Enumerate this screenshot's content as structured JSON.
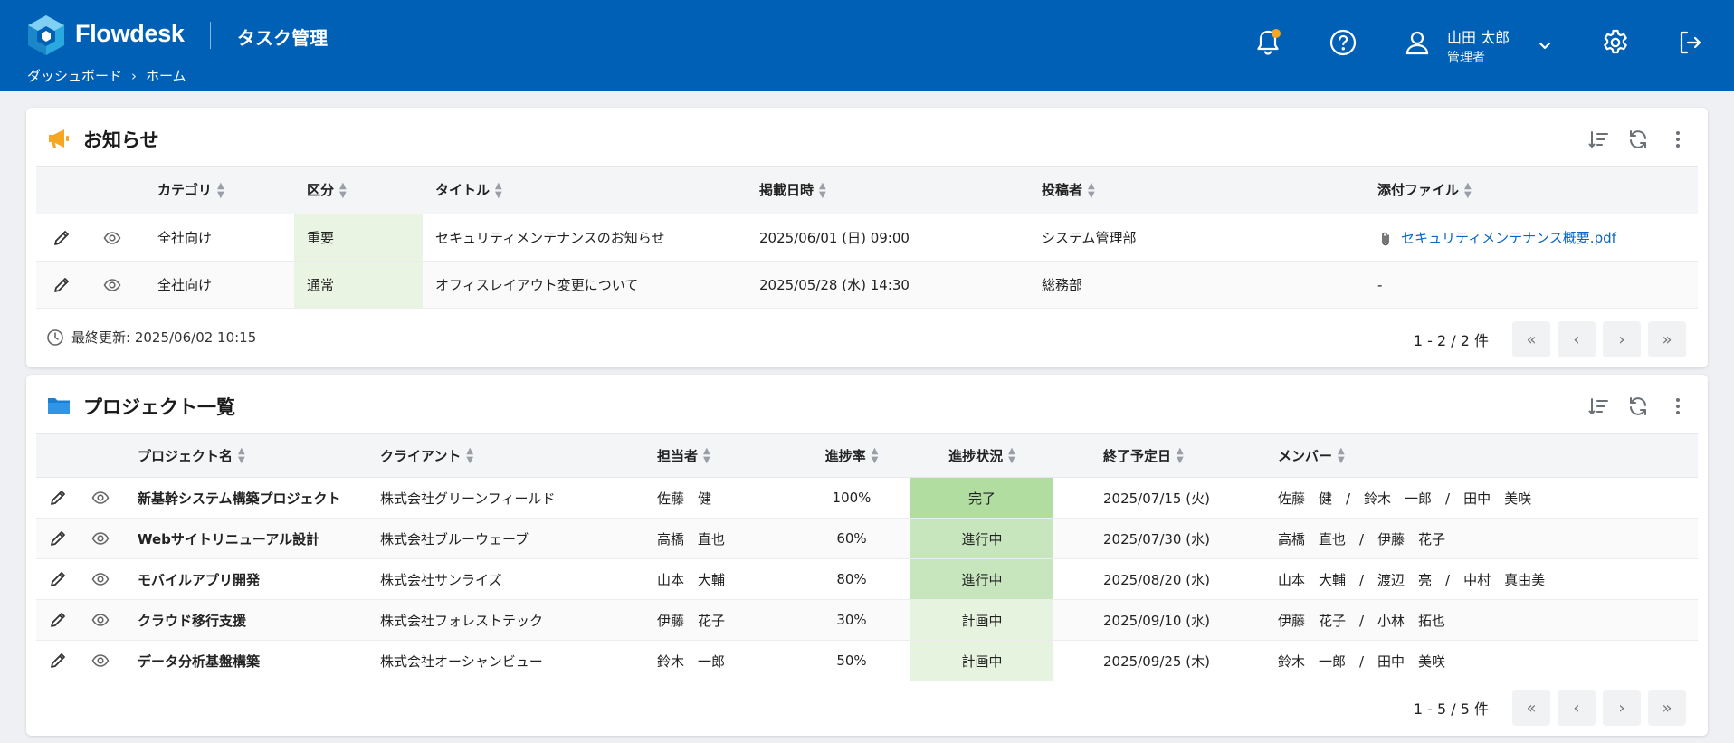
{
  "header": {
    "brand": "Flowdesk",
    "app_title": "タスク管理",
    "breadcrumb": [
      "ダッシュボード",
      "ホーム"
    ],
    "user_name": "山田 太郎",
    "user_role": "管理者"
  },
  "notices": {
    "title": "お知らせ",
    "columns": [
      "カテゴリ",
      "区分",
      "タイトル",
      "掲載日時",
      "投稿者",
      "添付ファイル"
    ],
    "rows": [
      {
        "category": "全社向け",
        "type": "重要",
        "title": "セキュリティメンテナンスのお知らせ",
        "date": "2025/06/01 (日) 09:00",
        "author": "システム管理部",
        "attachment": "セキュリティメンテナンス概要.pdf"
      },
      {
        "category": "全社向け",
        "type": "通常",
        "title": "オフィスレイアウト変更について",
        "date": "2025/05/28 (水) 14:30",
        "author": "総務部",
        "attachment": "-"
      }
    ],
    "updated": "最終更新: 2025/06/02 10:15",
    "count": "1 - 2 / 2 件"
  },
  "projects": {
    "title": "プロジェクト一覧",
    "columns": [
      "プロジェクト名",
      "クライアント",
      "担当者",
      "進捗率",
      "進捗状況",
      "終了予定日",
      "メンバー"
    ],
    "rows": [
      {
        "name": "新基幹システム構築プロジェクト",
        "client": "株式会社グリーンフィールド",
        "owner": "佐藤　健",
        "progress": "100%",
        "status": "完了",
        "due": "2025/07/15 (火)",
        "members": "佐藤　健　/　鈴木　一郎　/　田中　美咲"
      },
      {
        "name": "Webサイトリニューアル設計",
        "client": "株式会社ブルーウェーブ",
        "owner": "高橋　直也",
        "progress": "60%",
        "status": "進行中",
        "due": "2025/07/30 (水)",
        "members": "高橋　直也　/　伊藤　花子"
      },
      {
        "name": "モバイルアプリ開発",
        "client": "株式会社サンライズ",
        "owner": "山本　大輔",
        "progress": "80%",
        "status": "進行中",
        "due": "2025/08/20 (水)",
        "members": "山本　大輔　/　渡辺　亮　/　中村　真由美"
      },
      {
        "name": "クラウド移行支援",
        "client": "株式会社フォレストテック",
        "owner": "伊藤　花子",
        "progress": "30%",
        "status": "計画中",
        "due": "2025/09/10 (水)",
        "members": "伊藤　花子　/　小林　拓也"
      },
      {
        "name": "データ分析基盤構築",
        "client": "株式会社オーシャンビュー",
        "owner": "鈴木　一郎",
        "progress": "50%",
        "status": "計画中",
        "due": "2025/09/25 (木)",
        "members": "鈴木　一郎　/　田中　美咲"
      }
    ],
    "count": "1 - 5 / 5 件"
  },
  "pager_icons": [
    "«",
    "‹",
    "›",
    "»"
  ],
  "colors": {
    "header_bg": "#0060b6",
    "notif_dot": "#f5a623",
    "status_done": "#b1dda1",
    "status_progress": "#c8e6bd",
    "status_planned": "#e6f3df",
    "link": "#0a66c2"
  }
}
